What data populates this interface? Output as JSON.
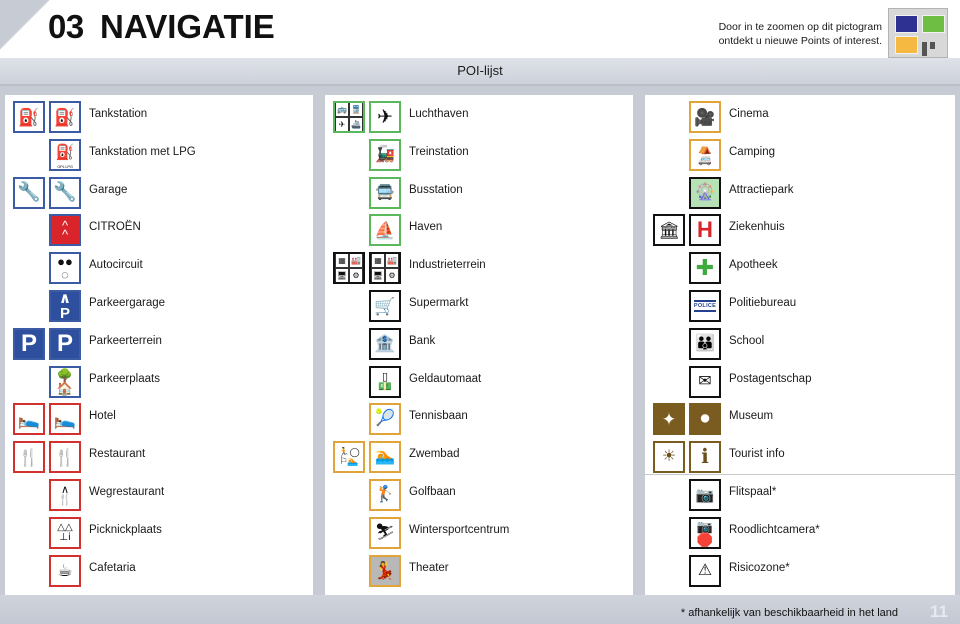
{
  "header": {
    "chapter_number": "03",
    "chapter_title": "NAVIGATIE",
    "note_line1": "Door in te zoomen op dit pictogram",
    "note_line2": "ontdekt u nieuwe Points of interest.",
    "logo_colors": {
      "blue": "#2e3192",
      "green": "#6fbe44",
      "orange": "#f5b942",
      "dots": "#555555"
    }
  },
  "subtitle_bar": {
    "label": "POI-lijst"
  },
  "footer": {
    "footnote": "* afhankelijk van beschikbaarheid in het land",
    "page_number": "11"
  },
  "columns": [
    {
      "id": "column-1",
      "rows": [
        {
          "label": "Tankstation",
          "icon_a": "fuel-pump-icon",
          "icon_b": "fuel-pump-icon"
        },
        {
          "label": "Tankstation met LPG",
          "icon_a": null,
          "icon_b": "fuel-pump-lpg-icon"
        },
        {
          "label": "Garage",
          "icon_a": "wrench-icon",
          "icon_b": "wrench-icon"
        },
        {
          "label": "CITROËN",
          "icon_a": null,
          "icon_b": "citroen-chevrons-icon"
        },
        {
          "label": "Autocircuit",
          "icon_a": null,
          "icon_b": "race-track-icon"
        },
        {
          "label": "Parkeergarage",
          "icon_a": null,
          "icon_b": "parking-garage-icon"
        },
        {
          "label": "Parkeerterrein",
          "icon_a": "parking-p-icon",
          "icon_b": "parking-p-icon"
        },
        {
          "label": "Parkeerplaats",
          "icon_a": null,
          "icon_b": "rest-area-icon"
        },
        {
          "label": "Hotel",
          "icon_a": "bed-icon",
          "icon_b": "bed-icon"
        },
        {
          "label": "Restaurant",
          "icon_a": "cutlery-icon",
          "icon_b": "cutlery-icon"
        },
        {
          "label": "Wegrestaurant",
          "icon_a": null,
          "icon_b": "roadside-restaurant-icon"
        },
        {
          "label": "Picknickplaats",
          "icon_a": null,
          "icon_b": "picnic-table-icon"
        },
        {
          "label": "Cafetaria",
          "icon_a": null,
          "icon_b": "coffee-cup-icon"
        }
      ]
    },
    {
      "id": "column-2",
      "rows": [
        {
          "label": "Luchthaven",
          "icon_a": "transport-hub-icon",
          "icon_b": "airplane-icon"
        },
        {
          "label": "Treinstation",
          "icon_a": null,
          "icon_b": "locomotive-icon"
        },
        {
          "label": "Busstation",
          "icon_a": null,
          "icon_b": "bus-icon"
        },
        {
          "label": "Haven",
          "icon_a": null,
          "icon_b": "ferry-icon"
        },
        {
          "label": "Industrieterrein",
          "icon_a": "industry-grid-icon",
          "icon_b": "industry-grid-icon"
        },
        {
          "label": "Supermarkt",
          "icon_a": null,
          "icon_b": "shopping-cart-icon"
        },
        {
          "label": "Bank",
          "icon_a": null,
          "icon_b": "bank-building-icon"
        },
        {
          "label": "Geldautomaat",
          "icon_a": null,
          "icon_b": "atm-icon"
        },
        {
          "label": "Tennisbaan",
          "icon_a": null,
          "icon_b": "tennis-player-icon"
        },
        {
          "label": "Zwembad",
          "icon_a": "sports-collage-icon",
          "icon_b": "swimmer-icon"
        },
        {
          "label": "Golfbaan",
          "icon_a": null,
          "icon_b": "golfer-icon"
        },
        {
          "label": "Wintersportcentrum",
          "icon_a": null,
          "icon_b": "skier-icon"
        },
        {
          "label": "Theater",
          "icon_a": null,
          "icon_b": "theatre-dancer-icon"
        }
      ]
    },
    {
      "id": "column-3",
      "rows": [
        {
          "label": "Cinema",
          "icon_a": null,
          "icon_b": "film-reel-icon"
        },
        {
          "label": "Camping",
          "icon_a": null,
          "icon_b": "tent-caravan-icon"
        },
        {
          "label": "Attractiepark",
          "icon_a": null,
          "icon_b": "amusement-park-icon"
        },
        {
          "label": "Ziekenhuis",
          "icon_a": "classical-building-icon",
          "icon_b": "hospital-h-icon"
        },
        {
          "label": "Apotheek",
          "icon_a": null,
          "icon_b": "pharmacy-cross-icon"
        },
        {
          "label": "Politiebureau",
          "icon_a": null,
          "icon_b": "police-sign-icon"
        },
        {
          "label": "School",
          "icon_a": null,
          "icon_b": "school-children-icon"
        },
        {
          "label": "Postagentschap",
          "icon_a": null,
          "icon_b": "envelope-icon"
        },
        {
          "label": "Museum",
          "icon_a": "museum-ornament-icon",
          "icon_b": "museum-m-icon"
        },
        {
          "label": "Tourist info",
          "icon_a": "lighthouse-beam-icon",
          "icon_b": "info-i-icon"
        },
        {
          "label": "Flitspaal*",
          "icon_a": null,
          "icon_b": "speed-camera-icon",
          "separator_above": true
        },
        {
          "label": "Roodlichtcamera*",
          "icon_a": null,
          "icon_b": "red-light-camera-icon"
        },
        {
          "label": "Risicozone*",
          "icon_a": null,
          "icon_b": "hazard-zone-icon"
        }
      ]
    }
  ]
}
